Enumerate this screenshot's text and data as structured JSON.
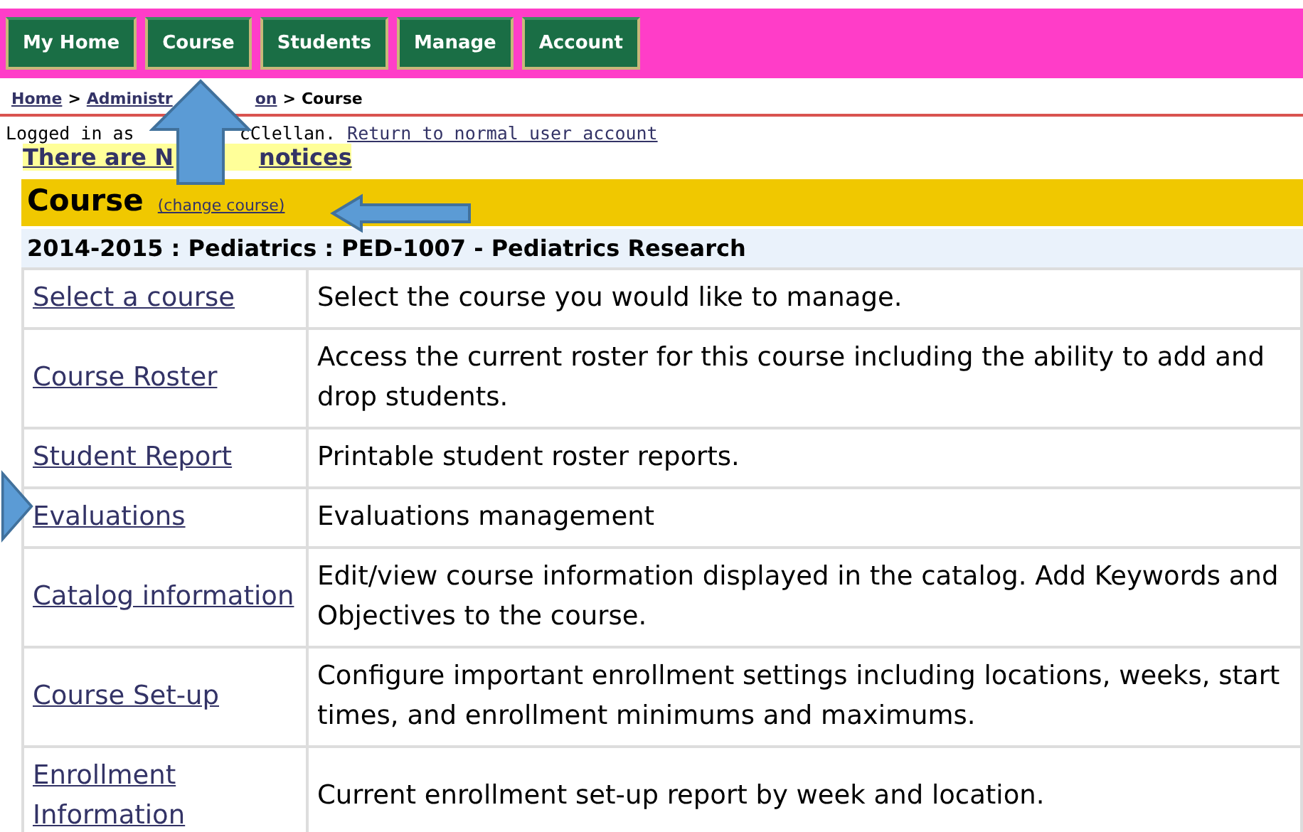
{
  "nav": {
    "tabs": [
      {
        "label": "My Home"
      },
      {
        "label": "Course"
      },
      {
        "label": "Students"
      },
      {
        "label": "Manage"
      },
      {
        "label": "Account"
      }
    ]
  },
  "breadcrumb": {
    "home": "Home",
    "separator": ">",
    "admin_start": "Administr",
    "admin_end": "on",
    "separator_2": ">",
    "current": "Course"
  },
  "login": {
    "prefix": "Logged in as",
    "name": "cClellan.",
    "link": "Return to normal user account"
  },
  "notices": {
    "before": "There are N",
    "after": "notices"
  },
  "course": {
    "title": "Course",
    "change_link": "(change course)",
    "subtitle": "2014-2015 : Pediatrics : PED-1007 - Pediatrics Research"
  },
  "table": {
    "rows": [
      {
        "link": "Select a course",
        "description": "Select the course you would like to manage."
      },
      {
        "link": "Course Roster",
        "description": "Access the current roster for this course including the ability to add and drop students."
      },
      {
        "link": "Student Report",
        "description": "Printable student roster reports."
      },
      {
        "link": "Evaluations",
        "description": "Evaluations management"
      },
      {
        "link": "Catalog information",
        "description": "Edit/view course information displayed in the catalog. Add Keywords and Objectives to the course."
      },
      {
        "link": "Course Set-up",
        "description": "Configure important enrollment settings including locations, weeks, start times, and enrollment minimums and maximums."
      },
      {
        "link": "Enrollment Information",
        "description": "Current enrollment set-up report by week and location."
      }
    ]
  }
}
